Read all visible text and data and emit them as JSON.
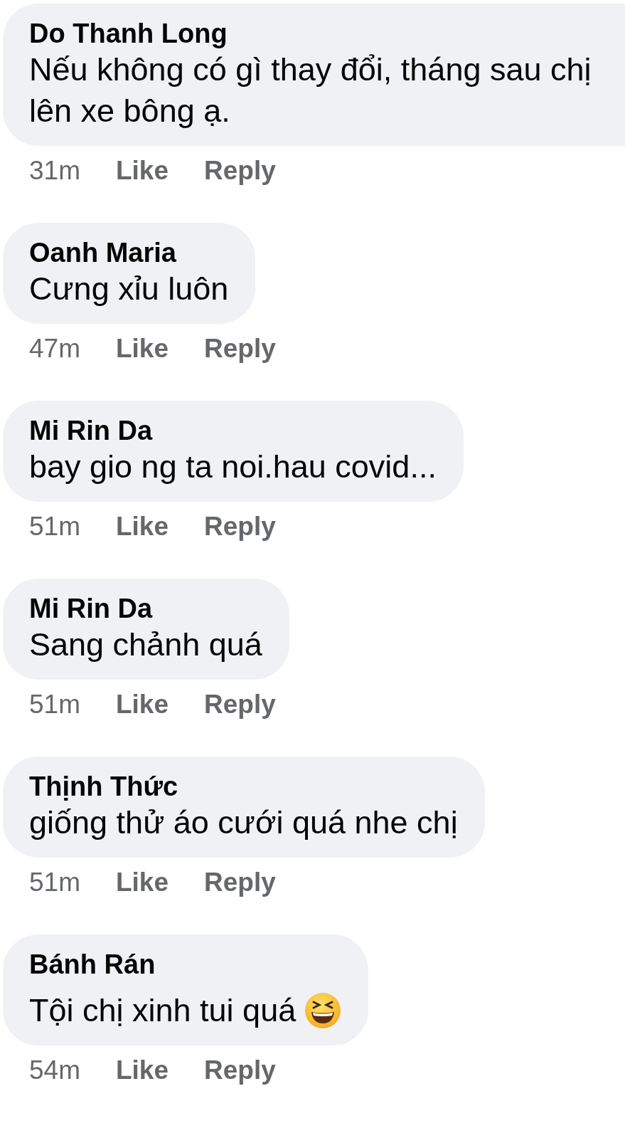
{
  "comments": [
    {
      "author": "Do Thanh Long",
      "lines": [
        "Nếu không có gì thay đổi, tháng sau chị",
        "lên xe bông ạ."
      ],
      "truncated": true,
      "emoji": false,
      "time": "31m",
      "like": "Like",
      "reply": "Reply"
    },
    {
      "author": "Oanh Maria",
      "lines": [
        "Cưng xỉu luôn"
      ],
      "truncated": false,
      "emoji": false,
      "time": "47m",
      "like": "Like",
      "reply": "Reply"
    },
    {
      "author": "Mi Rin Da",
      "lines": [
        "bay gio ng ta noi.hau covid..."
      ],
      "truncated": false,
      "emoji": false,
      "time": "51m",
      "like": "Like",
      "reply": "Reply"
    },
    {
      "author": "Mi Rin Da",
      "lines": [
        "Sang chảnh quá"
      ],
      "truncated": false,
      "emoji": false,
      "time": "51m",
      "like": "Like",
      "reply": "Reply"
    },
    {
      "author": "Thịnh Thức",
      "lines": [
        "giống thử áo cưới quá nhe chị"
      ],
      "truncated": false,
      "emoji": false,
      "time": "51m",
      "like": "Like",
      "reply": "Reply"
    },
    {
      "author": "Bánh Rán",
      "lines": [
        "Tội chị xinh tui quá"
      ],
      "truncated": false,
      "emoji": true,
      "time": "54m",
      "like": "Like",
      "reply": "Reply"
    }
  ]
}
